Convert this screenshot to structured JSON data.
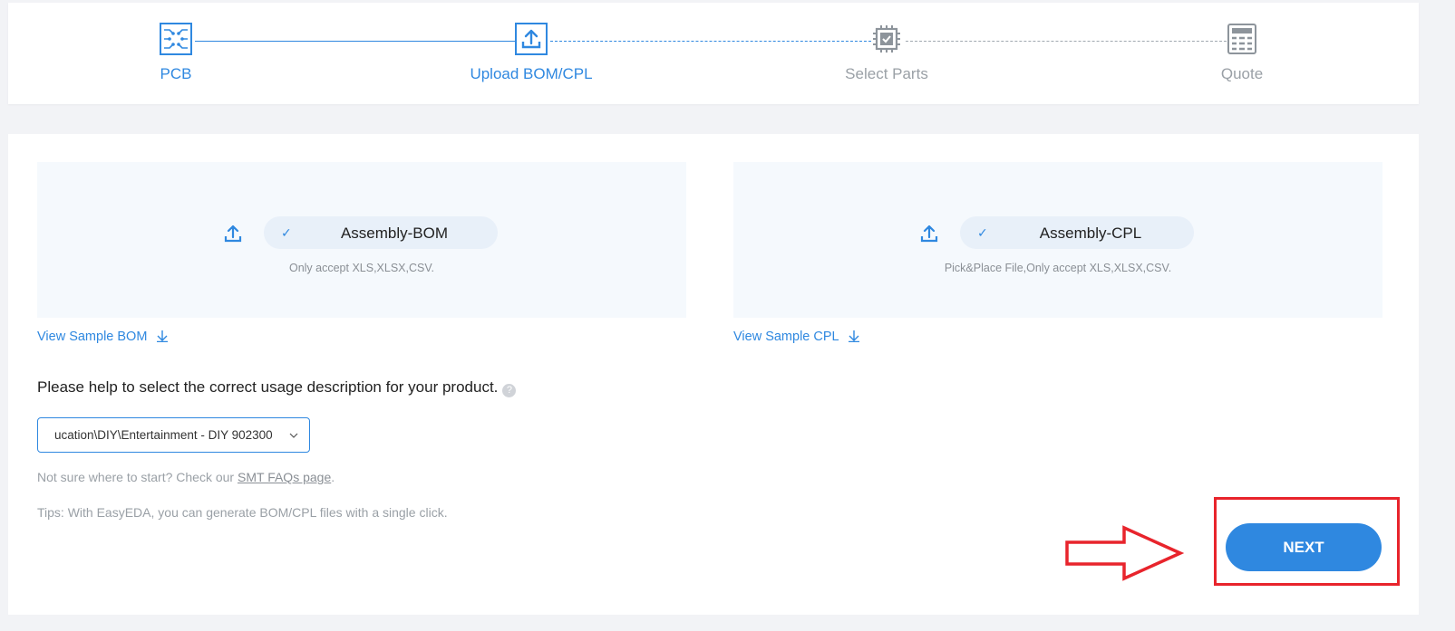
{
  "steps": [
    {
      "label": "PCB",
      "state": "active",
      "icon": "pcb-circuit-icon"
    },
    {
      "label": "Upload BOM/CPL",
      "state": "active",
      "icon": "upload-icon"
    },
    {
      "label": "Select Parts",
      "state": "inactive",
      "icon": "chip-icon"
    },
    {
      "label": "Quote",
      "state": "inactive",
      "icon": "calculator-icon"
    }
  ],
  "bom": {
    "file_name": "Assembly-BOM",
    "note": "Only accept XLS,XLSX,CSV.",
    "sample_link": "View Sample BOM"
  },
  "cpl": {
    "file_name": "Assembly-CPL",
    "note": "Pick&Place File,Only accept XLS,XLSX,CSV.",
    "sample_link": "View Sample CPL"
  },
  "usage": {
    "question": "Please help to select the correct usage description for your product.",
    "help_glyph": "?",
    "selected_value": "ucation\\DIY\\Entertainment - DIY 902300"
  },
  "faq": {
    "prefix": "Not sure where to start? Check our ",
    "link_text": "SMT FAQs page",
    "suffix": "."
  },
  "tips": "Tips: With EasyEDA, you can generate BOM/CPL files with a single click.",
  "next_label": "NEXT",
  "colors": {
    "accent": "#2f88e0",
    "inactive": "#9aa0a6",
    "annotation": "#e8242c"
  }
}
